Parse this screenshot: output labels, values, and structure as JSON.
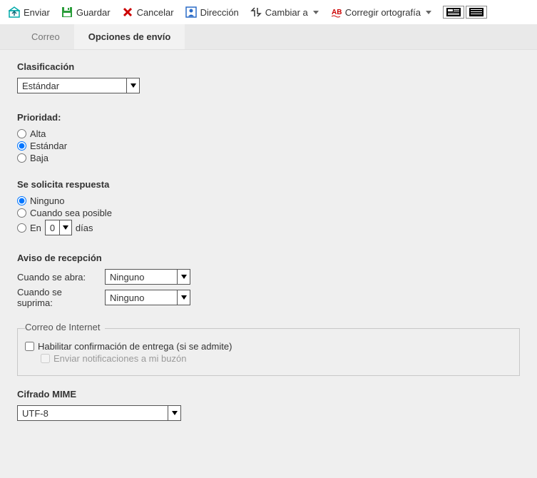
{
  "toolbar": {
    "send": "Enviar",
    "save": "Guardar",
    "cancel": "Cancelar",
    "address": "Dirección",
    "switch": "Cambiar a",
    "spellcheck": "Corregir ortografía"
  },
  "tabs": {
    "mail": "Correo",
    "send_options": "Opciones de envío"
  },
  "classification": {
    "title": "Clasificación",
    "value": "Estándar"
  },
  "priority": {
    "title": "Prioridad:",
    "options": {
      "high": "Alta",
      "standard": "Estándar",
      "low": "Baja"
    },
    "selected": "standard"
  },
  "reply": {
    "title": "Se solicita respuesta",
    "none": "Ninguno",
    "when_possible": "Cuando sea posible",
    "in_prefix": "En",
    "in_suffix": "días",
    "days_value": "0",
    "selected": "none"
  },
  "receipt": {
    "title": "Aviso de recepción",
    "on_open_label": "Cuando se abra:",
    "on_open_value": "Ninguno",
    "on_delete_label": "Cuando se suprima:",
    "on_delete_value": "Ninguno"
  },
  "internet": {
    "legend": "Correo de Internet",
    "enable_delivery": "Habilitar confirmación de entrega (si se admite)",
    "send_notifications": "Enviar notificaciones a mi buzón"
  },
  "mime": {
    "title": "Cifrado MIME",
    "value": "UTF-8"
  }
}
